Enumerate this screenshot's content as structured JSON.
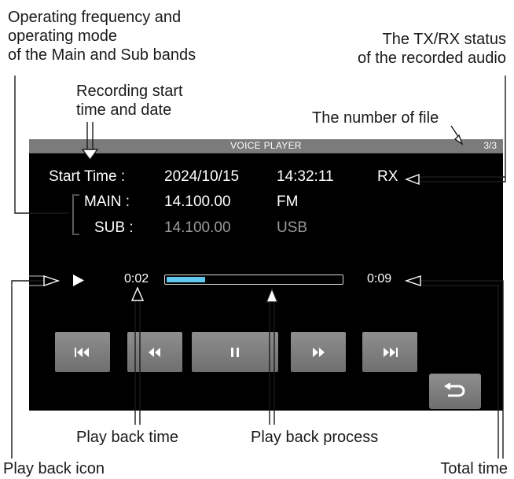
{
  "callouts": {
    "freq_mode_1": "Operating frequency and",
    "freq_mode_2": "operating mode",
    "freq_mode_3": "of the Main and Sub bands",
    "txrx_1": "The TX/RX status",
    "txrx_2": "of the recorded audio",
    "rec_start_1": "Recording start",
    "rec_start_2": "time and date",
    "file_number": "The number of file",
    "playback_time": "Play back time",
    "playback_process": "Play back process",
    "playback_icon": "Play back icon",
    "total_time": "Total time"
  },
  "screen": {
    "title": "VOICE PLAYER",
    "file_count": "3/3",
    "start_time_label": "Start Time :",
    "date": "2024/10/15",
    "time": "14:32:11",
    "status": "RX",
    "main_label": "MAIN :",
    "main_freq": "14.100.00",
    "main_mode": "FM",
    "sub_label": "SUB :",
    "sub_freq": "14.100.00",
    "sub_mode": "USB",
    "elapsed": "0:02",
    "total": "0:09",
    "progress": 0.22
  },
  "buttons": [
    "skip-back",
    "rewind",
    "pause",
    "fast-forward",
    "skip-forward",
    "return"
  ],
  "colors": {
    "progress_fill": "#5ec8ee",
    "button": "#7d7d7d",
    "titlebar": "#7b7b7b",
    "dimmed_text": "#9a9a9a"
  }
}
